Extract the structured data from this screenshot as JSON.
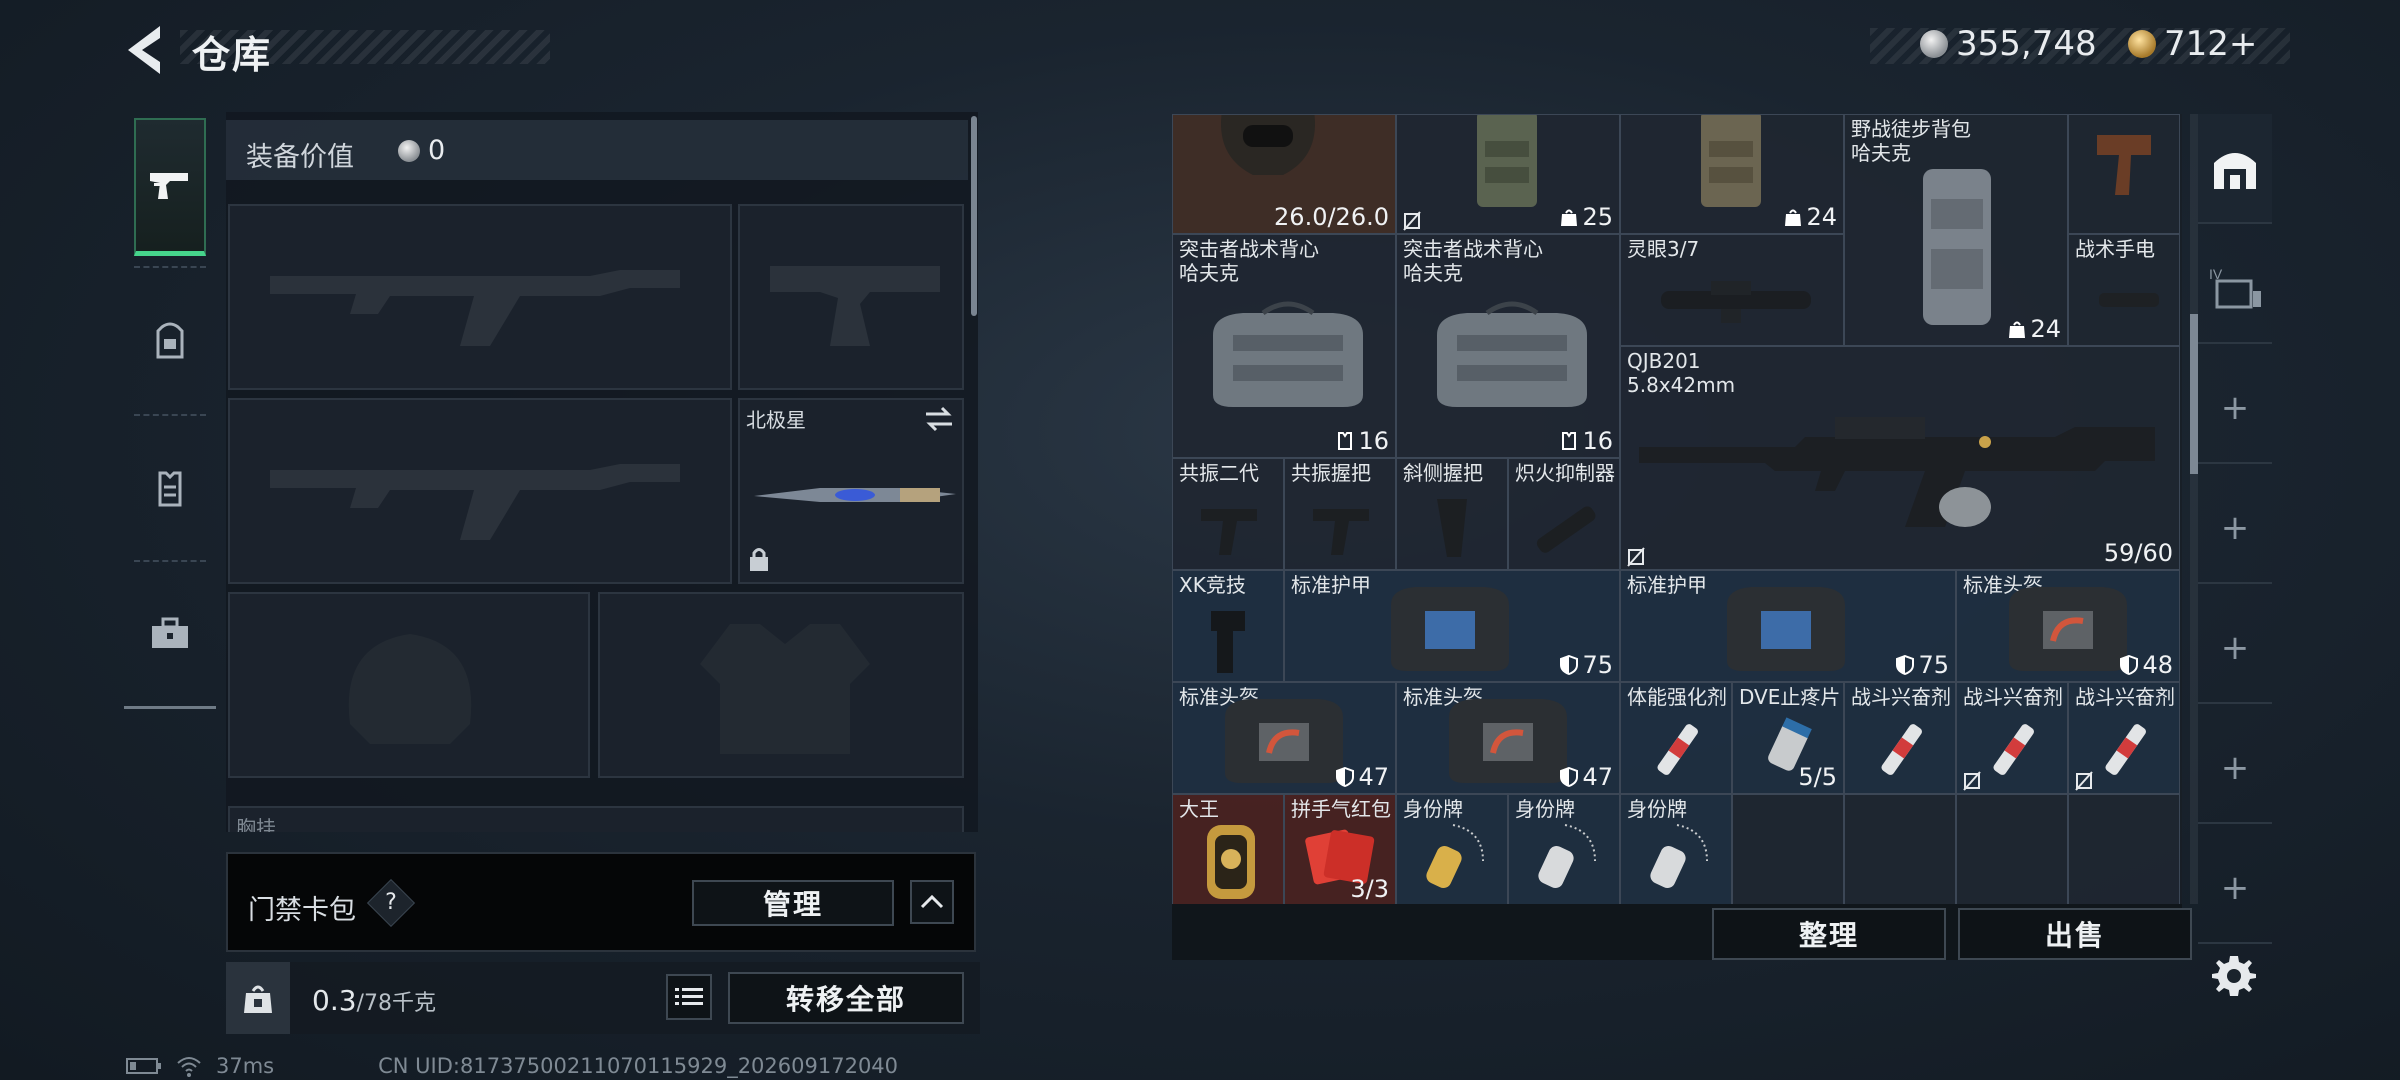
{
  "header": {
    "title": "仓库",
    "currency_primary": "355,748",
    "currency_secondary": "712+"
  },
  "rail": {
    "items": [
      {
        "icon": "pistol-icon",
        "active": true
      },
      {
        "icon": "backpack-icon",
        "active": false
      },
      {
        "icon": "vest-icon",
        "active": false
      },
      {
        "icon": "toolbox-icon",
        "active": false
      }
    ]
  },
  "equipment": {
    "value_label": "装备价值",
    "value": "0",
    "melee_slot_label": "北极星",
    "partial_label": "胸挂"
  },
  "keycard": {
    "label": "门禁卡包",
    "help": "?",
    "manage_button": "管理"
  },
  "weight": {
    "current": "0.3",
    "max": "/78千克",
    "transfer_all_button": "转移全部"
  },
  "status": {
    "ping": "37ms",
    "uid": "CN UID:81737500211070115929_202609172040"
  },
  "stash": {
    "items": [
      {
        "id": "helmet-durability",
        "name": "",
        "count": "26.0/26.0",
        "icon": "none"
      },
      {
        "id": "vest-a",
        "name": "",
        "count": "25",
        "icon": "lock-no"
      },
      {
        "id": "vest-b",
        "name": "",
        "count": "24",
        "icon": "weight"
      },
      {
        "id": "field-pack",
        "name": "野战徒步背包\n哈夫克",
        "count": "24",
        "icon": "weight"
      },
      {
        "id": "misc-top",
        "name": "",
        "count": "",
        "icon": "none"
      },
      {
        "id": "assault-vest-1",
        "name": "突击者战术背心\n哈夫克",
        "count": "16",
        "icon": "vest"
      },
      {
        "id": "assault-vest-2",
        "name": "突击者战术背心\n哈夫克",
        "count": "16",
        "icon": "vest"
      },
      {
        "id": "scope",
        "name": "灵眼3/7",
        "count": "",
        "icon": "none"
      },
      {
        "id": "flashlight",
        "name": "战术手电",
        "count": "",
        "icon": "none"
      },
      {
        "id": "rifle",
        "name": "QJB201\n5.8x42mm",
        "count": "59/60",
        "icon": "no-insure"
      },
      {
        "id": "grip-1",
        "name": "共振二代",
        "count": "",
        "icon": "none"
      },
      {
        "id": "grip-2",
        "name": "共振握把",
        "count": "",
        "icon": "none"
      },
      {
        "id": "grip-3",
        "name": "斜侧握把",
        "count": "",
        "icon": "none"
      },
      {
        "id": "suppressor",
        "name": "炽火抑制器",
        "count": "",
        "icon": "none"
      },
      {
        "id": "stock",
        "name": "XK竞技",
        "count": "",
        "icon": "none"
      },
      {
        "id": "armor-1",
        "name": "标准护甲",
        "count": "75",
        "icon": "shield"
      },
      {
        "id": "armor-2",
        "name": "标准护甲",
        "count": "75",
        "icon": "shield"
      },
      {
        "id": "helmet-1",
        "name": "标准头盔",
        "count": "48",
        "icon": "shield"
      },
      {
        "id": "helmet-2",
        "name": "标准头盔",
        "count": "47",
        "icon": "shield"
      },
      {
        "id": "helmet-3",
        "name": "标准头盔",
        "count": "47",
        "icon": "shield"
      },
      {
        "id": "stim-1",
        "name": "体能强化剂",
        "count": "",
        "icon": "none"
      },
      {
        "id": "tourniquet",
        "name": "DVE止疼片",
        "count": "5/5",
        "icon": "none"
      },
      {
        "id": "stim-2",
        "name": "战斗兴奋剂",
        "count": "",
        "icon": "none"
      },
      {
        "id": "stim-3",
        "name": "战斗兴奋剂",
        "count": "",
        "icon": "no-insure"
      },
      {
        "id": "stim-4",
        "name": "战斗兴奋剂",
        "count": "",
        "icon": "no-insure"
      },
      {
        "id": "king",
        "name": "大王",
        "count": "",
        "icon": "none"
      },
      {
        "id": "redpacket",
        "name": "拼手气红包",
        "count": "3/3",
        "icon": "none"
      },
      {
        "id": "dogtag-1",
        "name": "身份牌",
        "count": "",
        "icon": "none"
      },
      {
        "id": "dogtag-2",
        "name": "身份牌",
        "count": "",
        "icon": "none"
      },
      {
        "id": "dogtag-3",
        "name": "身份牌",
        "count": "",
        "icon": "none"
      }
    ],
    "sort_button": "整理",
    "sell_button": "出售"
  },
  "right_tabs": {
    "items": [
      {
        "icon": "stash-icon",
        "label": ""
      },
      {
        "icon": "container-iv-icon",
        "label": "IV"
      },
      {
        "icon": "plus-icon",
        "label": "+"
      },
      {
        "icon": "plus-icon",
        "label": "+"
      },
      {
        "icon": "plus-icon",
        "label": "+"
      },
      {
        "icon": "plus-icon",
        "label": "+"
      },
      {
        "icon": "plus-icon",
        "label": "+"
      }
    ]
  },
  "colors": {
    "accent_green": "#46d58c",
    "panel_dark": "#121820",
    "cell_border": "#3c4756"
  }
}
